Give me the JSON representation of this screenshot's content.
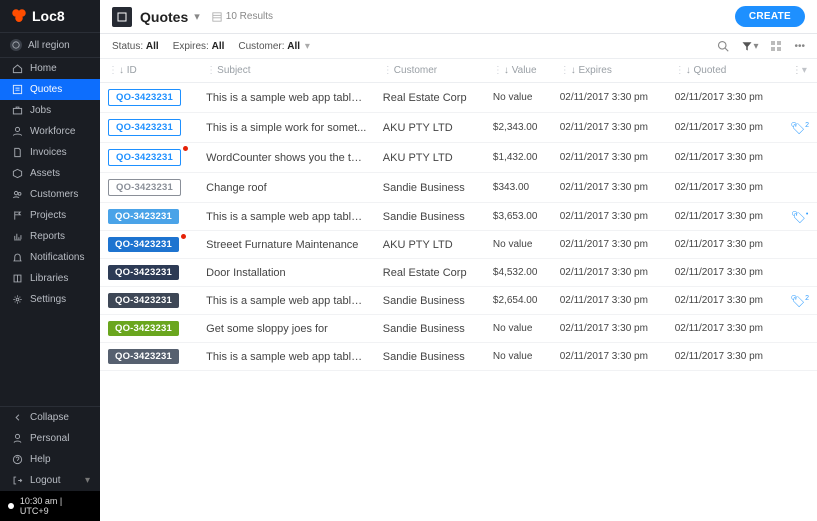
{
  "brand": "Loc8",
  "region_label": "All region",
  "nav": [
    {
      "label": "Home",
      "icon": "home"
    },
    {
      "label": "Quotes",
      "icon": "quote",
      "active": true
    },
    {
      "label": "Jobs",
      "icon": "briefcase"
    },
    {
      "label": "Workforce",
      "icon": "user"
    },
    {
      "label": "Invoices",
      "icon": "file"
    },
    {
      "label": "Assets",
      "icon": "cube"
    },
    {
      "label": "Customers",
      "icon": "users"
    },
    {
      "label": "Projects",
      "icon": "flag"
    },
    {
      "label": "Reports",
      "icon": "chart"
    },
    {
      "label": "Notifications",
      "icon": "bell"
    },
    {
      "label": "Libraries",
      "icon": "book"
    },
    {
      "label": "Settings",
      "icon": "gear"
    }
  ],
  "footer_nav": [
    {
      "label": "Collapse",
      "icon": "collapse"
    },
    {
      "label": "Personal",
      "icon": "person"
    },
    {
      "label": "Help",
      "icon": "help"
    },
    {
      "label": "Logout",
      "icon": "logout"
    }
  ],
  "status_time": "10:30 am | UTC+9",
  "page": {
    "title": "Quotes",
    "results_text": "10 Results",
    "create_label": "CREATE"
  },
  "filters": {
    "label_status": "Status:",
    "value_status": "All",
    "label_expires": "Expires:",
    "value_expires": "All",
    "label_customer": "Customer:",
    "value_customer": "All"
  },
  "columns": {
    "id": "ID",
    "subject": "Subject",
    "customer": "Customer",
    "value": "Value",
    "expires": "Expires",
    "quoted": "Quoted"
  },
  "rows": [
    {
      "id": "QO-3423231",
      "chip": "outline-blue",
      "dot": false,
      "subject": "This is a sample web app tablet...",
      "customer": "Real Estate Corp",
      "value": "No value",
      "expires": "02/11/2017 3:30 pm",
      "quoted": "02/11/2017 3:30 pm",
      "flag": ""
    },
    {
      "id": "QO-3423231",
      "chip": "outline-blue",
      "dot": false,
      "subject": "This is a simple work for somet...",
      "customer": "AKU PTY LTD",
      "value": "$2,343.00",
      "expires": "02/11/2017 3:30 pm",
      "quoted": "02/11/2017 3:30 pm",
      "flag": "2"
    },
    {
      "id": "QO-3423231",
      "chip": "outline-blue",
      "dot": true,
      "subject": "WordCounter shows you the top...",
      "customer": "AKU PTY LTD",
      "value": "$1,432.00",
      "expires": "02/11/2017 3:30 pm",
      "quoted": "02/11/2017 3:30 pm",
      "flag": ""
    },
    {
      "id": "QO-3423231",
      "chip": "outline-grey",
      "dot": false,
      "subject": "Change roof",
      "customer": "Sandie Business",
      "value": "$343.00",
      "expires": "02/11/2017 3:30 pm",
      "quoted": "02/11/2017 3:30 pm",
      "flag": ""
    },
    {
      "id": "QO-3423231",
      "chip": "fill-lightblue",
      "dot": false,
      "subject": "This is a sample web app tablet...",
      "customer": "Sandie Business",
      "value": "$3,653.00",
      "expires": "02/11/2017 3:30 pm",
      "quoted": "02/11/2017 3:30 pm",
      "flag": "•"
    },
    {
      "id": "QO-3423231",
      "chip": "fill-blue",
      "dot": true,
      "subject": "Streeet Furnature Maintenance",
      "customer": "AKU PTY LTD",
      "value": "No value",
      "expires": "02/11/2017 3:30 pm",
      "quoted": "02/11/2017 3:30 pm",
      "flag": ""
    },
    {
      "id": "QO-3423231",
      "chip": "fill-navy",
      "dot": false,
      "subject": "Door Installation",
      "customer": "Real Estate Corp",
      "value": "$4,532.00",
      "expires": "02/11/2017 3:30 pm",
      "quoted": "02/11/2017 3:30 pm",
      "flag": ""
    },
    {
      "id": "QO-3423231",
      "chip": "fill-dark",
      "dot": false,
      "subject": "This is a sample web app tablet...",
      "customer": "Sandie Business",
      "value": "$2,654.00",
      "expires": "02/11/2017 3:30 pm",
      "quoted": "02/11/2017 3:30 pm",
      "flag": "2"
    },
    {
      "id": "QO-3423231",
      "chip": "fill-green",
      "dot": false,
      "subject": "Get some sloppy joes for",
      "customer": "Sandie Business",
      "value": "No value",
      "expires": "02/11/2017 3:30 pm",
      "quoted": "02/11/2017 3:30 pm",
      "flag": ""
    },
    {
      "id": "QO-3423231",
      "chip": "fill-slate",
      "dot": false,
      "subject": "This is a sample web app tablet...",
      "customer": "Sandie Business",
      "value": "No value",
      "expires": "02/11/2017 3:30 pm",
      "quoted": "02/11/2017 3:30 pm",
      "flag": ""
    }
  ]
}
